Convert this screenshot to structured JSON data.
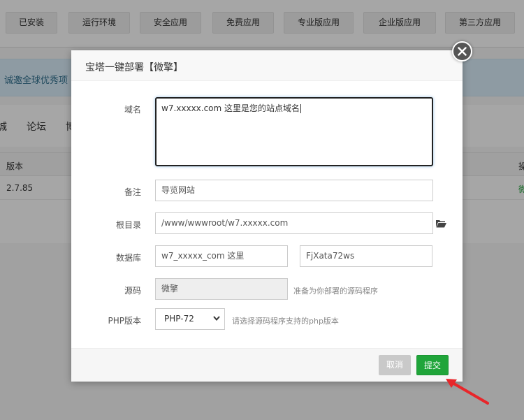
{
  "background": {
    "categories": [
      "已安装",
      "运行环境",
      "安全应用",
      "免费应用",
      "专业版应用",
      "企业版应用",
      "第三方应用"
    ],
    "notice": "诚邀全球优秀项",
    "sub_tabs": [
      "城",
      "论坛",
      "博"
    ],
    "table": {
      "header_version": "版本",
      "header_action": "操",
      "row_version": "2.7.85",
      "row_action": "微"
    }
  },
  "modal": {
    "title": "宝塔一键部署【微擎】",
    "fields": {
      "domain": {
        "label": "域名",
        "value": "w7.xxxxx.com 这里是您的站点域名"
      },
      "note": {
        "label": "备注",
        "value": "导览网站"
      },
      "root": {
        "label": "根目录",
        "value": "/www/wwwroot/w7.xxxxx.com"
      },
      "database": {
        "label": "数据库",
        "name_value": "w7_xxxxx_com 这里",
        "password_value": "FjXata72ws"
      },
      "source": {
        "label": "源码",
        "value": "微擎",
        "hint": "准备为你部署的源码程序"
      },
      "php": {
        "label": "PHP版本",
        "selected": "PHP-72",
        "hint": "请选择源码程序支持的php版本"
      }
    },
    "buttons": {
      "cancel": "取消",
      "submit": "提交"
    }
  },
  "colors": {
    "submit_green": "#20a53a",
    "annotation_red": "#e8262a"
  }
}
